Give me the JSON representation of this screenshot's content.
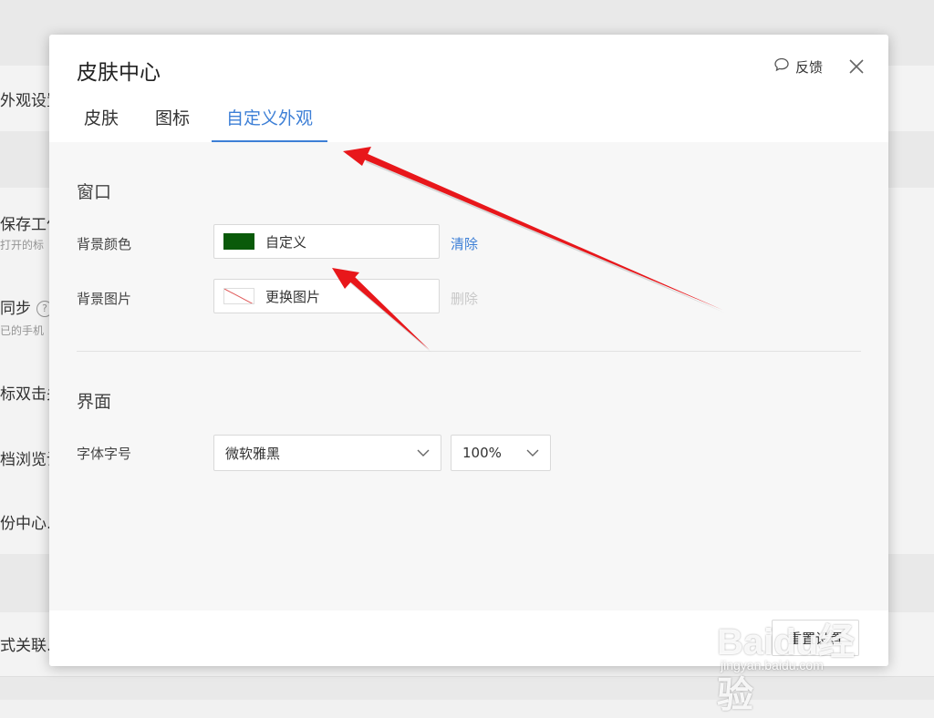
{
  "background": {
    "rows": [
      {
        "text": "外观设置"
      },
      {
        "text": "保存工作",
        "sub": "打开的标"
      },
      {
        "text": "同步",
        "sub": "已的手机",
        "help": "?"
      },
      {
        "text": "标双击关"
      },
      {
        "text": "档浏览设"
      },
      {
        "text": "份中心..."
      },
      {
        "text": "式关联..."
      }
    ]
  },
  "modal": {
    "title": "皮肤中心",
    "feedback_label": "反馈",
    "tabs": [
      {
        "label": "皮肤"
      },
      {
        "label": "图标"
      },
      {
        "label": "自定义外观"
      }
    ],
    "window_section": {
      "title": "窗口",
      "bg_color_label": "背景颜色",
      "bg_color_value": "自定义",
      "bg_color_swatch": "#0a5a0a",
      "clear_label": "清除",
      "bg_image_label": "背景图片",
      "bg_image_value": "更换图片",
      "delete_label": "删除"
    },
    "interface_section": {
      "title": "界面",
      "font_label": "字体字号",
      "font_value": "微软雅黑",
      "size_value": "100%"
    },
    "reset_label": "重置设置"
  },
  "colors": {
    "accent": "#3d7fd6",
    "arrow": "#e8171b"
  },
  "watermark": {
    "main": "Baidu经验",
    "sub": "jingyan.baidu.com"
  }
}
